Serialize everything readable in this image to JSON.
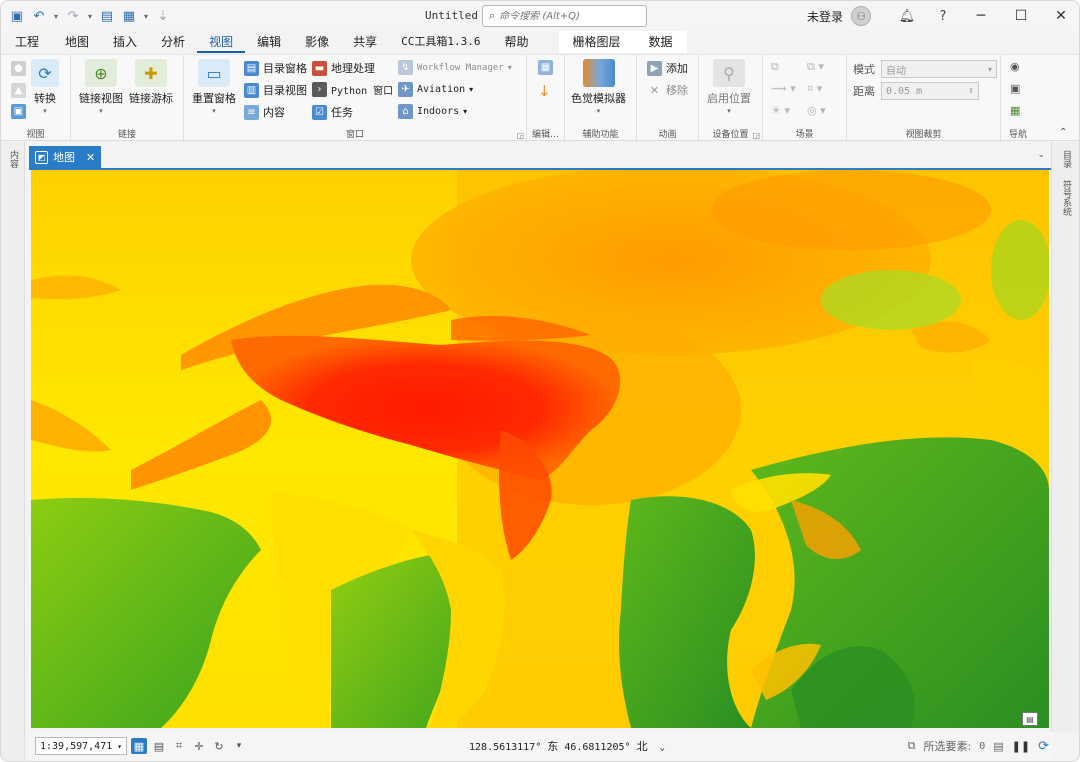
{
  "window": {
    "title": "Untitled",
    "search_placeholder": "命令搜索 (Alt+Q)",
    "user_label": "未登录"
  },
  "tabs": [
    {
      "label": "工程"
    },
    {
      "label": "地图"
    },
    {
      "label": "插入"
    },
    {
      "label": "分析"
    },
    {
      "label": "视图",
      "active": true
    },
    {
      "label": "编辑"
    },
    {
      "label": "影像"
    },
    {
      "label": "共享"
    },
    {
      "label": "CC工具箱1.3.6"
    },
    {
      "label": "帮助"
    },
    {
      "label": "栅格图层",
      "contextual": true
    },
    {
      "label": "数据",
      "contextual": true
    }
  ],
  "ribbon": {
    "view": {
      "label": "视图",
      "convert": "转换"
    },
    "link": {
      "label": "链接",
      "link_views": "链接视图",
      "link_cursor": "链接游标"
    },
    "windows": {
      "label": "窗口",
      "reset_panes": "重置窗格",
      "catalog_pane": "目录窗格",
      "catalog_view": "目录视图",
      "contents": "内容",
      "geoprocessing": "地理处理",
      "python_window": "Python 窗口",
      "tasks": "任务",
      "workflow_manager": "Workflow Manager",
      "aviation": "Aviation",
      "indoors": "Indoors"
    },
    "edit_group": {
      "label": "编辑…"
    },
    "accessibility": {
      "label": "辅助功能",
      "color_simulator": "色觉模拟器"
    },
    "animation": {
      "label": "动画",
      "add": "添加",
      "remove": "移除"
    },
    "device_location": {
      "label": "设备位置",
      "enable": "启用位置"
    },
    "scene": {
      "label": "场景"
    },
    "view_clipping": {
      "label": "视图裁剪",
      "mode_label": "模式",
      "mode_value": "自动",
      "distance_label": "距离",
      "distance_value": "0.05 m"
    },
    "navigate": {
      "label": "导航"
    }
  },
  "side_panels": {
    "left": "内容",
    "right": [
      "目录",
      "符号系统"
    ]
  },
  "map_view": {
    "tab_label": "地图"
  },
  "status_bar": {
    "scale": "1:39,597,471",
    "longitude": "128.5613117°",
    "longitude_dir": "东",
    "latitude": "46.6811205°",
    "latitude_dir": "北",
    "selected_features_label": "所选要素:",
    "selected_count": "0"
  },
  "colors": {
    "accent": "#2a7bc8",
    "dem_low": "#2f9e1f",
    "dem_mid": "#ffe600",
    "dem_high": "#ff1e00"
  }
}
